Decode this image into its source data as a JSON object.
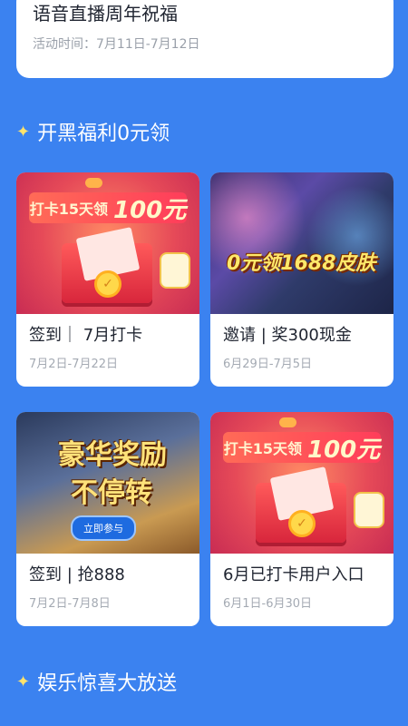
{
  "top_card": {
    "title": "语音直播周年祝福",
    "date_text": "活动时间：7月11日-7月12日"
  },
  "sections": [
    {
      "title": "开黑福利0元领"
    },
    {
      "title": "娱乐惊喜大放送"
    }
  ],
  "cards": [
    {
      "title": "签到｜ 7月打卡",
      "date": "7月2日-7月22日",
      "banner": {
        "ribbon_prefix": "打卡15天领",
        "ribbon_amount": "100元",
        "coin": "✓"
      }
    },
    {
      "title": "邀请 | 奖300现金",
      "date": "6月29日-7月5日",
      "banner": {
        "headline": "0元领1688皮肤"
      }
    },
    {
      "title": "签到 | 抢888",
      "date": "7月2日-7月8日",
      "banner": {
        "headline_1": "豪华奖励",
        "headline_2": "不停转",
        "cta": "立即参与"
      }
    },
    {
      "title": "6月已打卡用户入口",
      "date": "6月1日-6月30日",
      "banner": {
        "ribbon_prefix": "打卡15天领",
        "ribbon_amount": "100元",
        "coin": "✓"
      }
    }
  ],
  "colors": {
    "background": "#3b82f0",
    "sparkle": "#ffe36b"
  },
  "icons": {
    "section_marker": "sparkle-icon"
  }
}
